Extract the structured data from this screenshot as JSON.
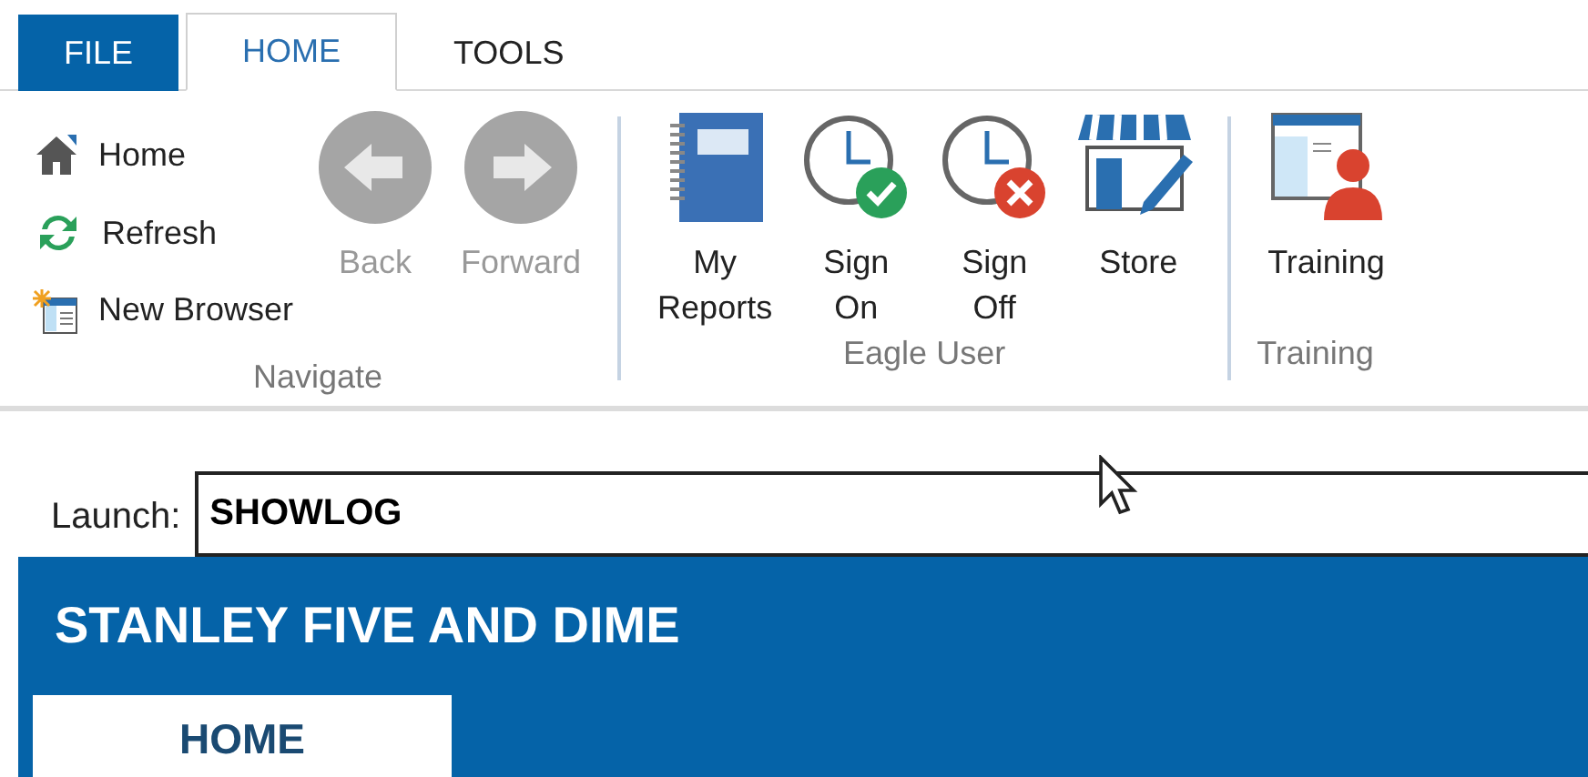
{
  "tabs": [
    {
      "label": "FILE",
      "kind": "file",
      "selected": false
    },
    {
      "label": "HOME",
      "kind": "tab",
      "selected": true
    },
    {
      "label": "TOOLS",
      "kind": "tab",
      "selected": false
    }
  ],
  "ribbon": {
    "groups": [
      {
        "label": "Navigate",
        "items": [
          {
            "kind": "small",
            "label": "Home",
            "disabled": false
          },
          {
            "kind": "small",
            "label": "Refresh",
            "disabled": false
          },
          {
            "kind": "small",
            "label": "New Browser",
            "disabled": false
          },
          {
            "kind": "large",
            "label": "Back",
            "disabled": true
          },
          {
            "kind": "large",
            "label": "Forward",
            "disabled": true
          }
        ]
      },
      {
        "label": "Eagle User",
        "items": [
          {
            "kind": "large",
            "label": "My\nReports",
            "disabled": false
          },
          {
            "kind": "large",
            "label": "Sign\nOn",
            "disabled": false
          },
          {
            "kind": "large",
            "label": "Sign\nOff",
            "disabled": false
          },
          {
            "kind": "large",
            "label": "Store",
            "disabled": false
          }
        ]
      },
      {
        "label": "Training",
        "items": [
          {
            "kind": "large",
            "label": "Training",
            "disabled": false
          }
        ]
      }
    ]
  },
  "launch": {
    "label": "Launch:",
    "value": "SHOWLOG"
  },
  "app": {
    "title": "STANLEY FIVE AND DIME",
    "tabs": [
      {
        "label": "HOME",
        "selected": true
      }
    ]
  }
}
